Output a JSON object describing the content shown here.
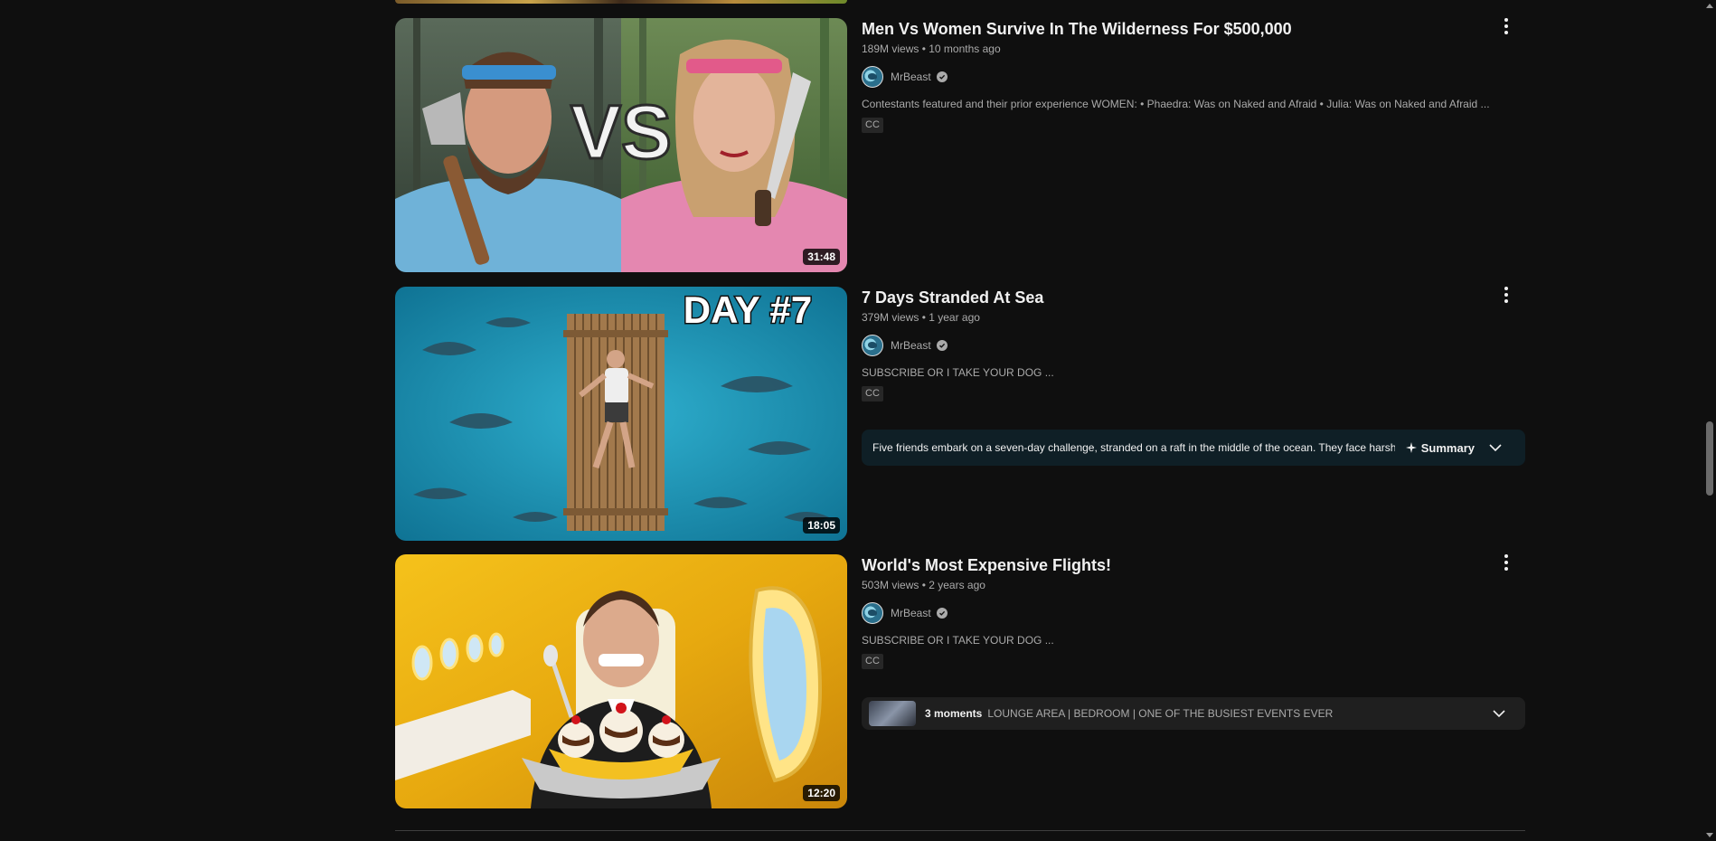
{
  "videos": [
    {
      "title": "Men Vs Women Survive In The Wilderness For $500,000",
      "meta": "189M views • 10 months ago",
      "channel": "MrBeast",
      "description": "Contestants featured and their prior experience WOMEN: • Phaedra: Was on Naked and Afraid • Julia: Was on Naked and Afraid ...",
      "cc": "CC",
      "duration": "31:48",
      "thumb_text": "VS"
    },
    {
      "title": "7 Days Stranded At Sea",
      "meta": "379M views • 1 year ago",
      "channel": "MrBeast",
      "description": "SUBSCRIBE OR I TAKE YOUR DOG ...",
      "cc": "CC",
      "duration": "18:05",
      "thumb_text": "DAY #7",
      "summary": {
        "text": "Five friends embark on a seven-day challenge, stranded on a raft in the middle of the ocean. They face harsh...",
        "label": "Summary"
      }
    },
    {
      "title": "World's Most Expensive Flights!",
      "meta": "503M views • 2 years ago",
      "channel": "MrBeast",
      "description": "SUBSCRIBE OR I TAKE YOUR DOG ...",
      "cc": "CC",
      "duration": "12:20",
      "moments": {
        "count": "3 moments",
        "list": "LOUNGE AREA | BEDROOM | ONE OF THE BUSIEST EVENTS EVER"
      }
    }
  ]
}
